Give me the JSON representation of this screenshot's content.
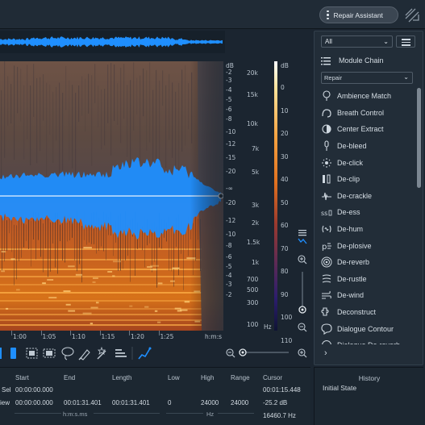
{
  "header": {
    "repair_assistant": "Repair Assistant",
    "logo_icon": "rx-logo-icon"
  },
  "left_scale": {
    "unit": "dB",
    "ticks": [
      "-2",
      "-3",
      "-4",
      "-5",
      "-6",
      "-8",
      "-10",
      "-12",
      "-15",
      "-20",
      "-∞",
      "-20",
      "-12",
      "-10",
      "-8",
      "-6",
      "-5",
      "-4",
      "-3",
      "-2"
    ]
  },
  "freq_scale": {
    "ticks": [
      "20k",
      "15k",
      "10k",
      "7k",
      "5k",
      "3k",
      "2k",
      "1.5k",
      "1k",
      "700",
      "500",
      "300",
      "100"
    ],
    "unit": "Hz"
  },
  "color_scale": {
    "unit": "dB",
    "ticks": [
      "0",
      "10",
      "20",
      "30",
      "40",
      "50",
      "60",
      "70",
      "80",
      "90",
      "100",
      "110"
    ]
  },
  "timeline": {
    "ticks": [
      "1:00",
      "1:05",
      "1:10",
      "1:15",
      "1:20",
      "1:25"
    ],
    "unit": "h:m:s"
  },
  "toolbar": {
    "icons": [
      "time-select-icon",
      "box-select-icon",
      "lasso-select-icon",
      "brush-select-icon",
      "magic-wand-icon",
      "harmonic-select-icon",
      "instant-process-icon",
      "zoom-out-icon",
      "zoom-slider",
      "zoom-in-icon"
    ]
  },
  "panel": {
    "filter": "All",
    "module_chain": "Module Chain",
    "category": "Repair",
    "modules": [
      "Ambience Match",
      "Breath Control",
      "Center Extract",
      "De-bleed",
      "De-click",
      "De-clip",
      "De-crackle",
      "De-ess",
      "De-hum",
      "De-plosive",
      "De-reverb",
      "De-rustle",
      "De-wind",
      "Deconstruct",
      "Dialogue Contour",
      "Dialogue De-reverb"
    ]
  },
  "info": {
    "headers": {
      "start": "Start",
      "end": "End",
      "length": "Length",
      "low": "Low",
      "high": "High",
      "range": "Range",
      "cursor": "Cursor"
    },
    "sel_label": "Sel",
    "view_label": "iew",
    "sel": {
      "start": "00:00:00.000",
      "end": "",
      "length": ""
    },
    "view": {
      "start": "00:00:00.000",
      "end": "00:01:31.401",
      "length": "00:01:31.401",
      "low": "0",
      "high": "24000",
      "range": "24000"
    },
    "time_unit": "h:m:s.ms",
    "freq_unit": "Hz",
    "cursor": {
      "time": "00:01:15.448",
      "level": "-25.2 dB",
      "freq": "16460.7 Hz"
    }
  },
  "history": {
    "title": "History",
    "entry": "Initial State"
  },
  "colors": {
    "accent": "#1f8fff",
    "background": "#1b2530",
    "panel": "#222d38",
    "waveform": "#1e90ff",
    "spectrogram_hot": "#ff9b2e"
  }
}
